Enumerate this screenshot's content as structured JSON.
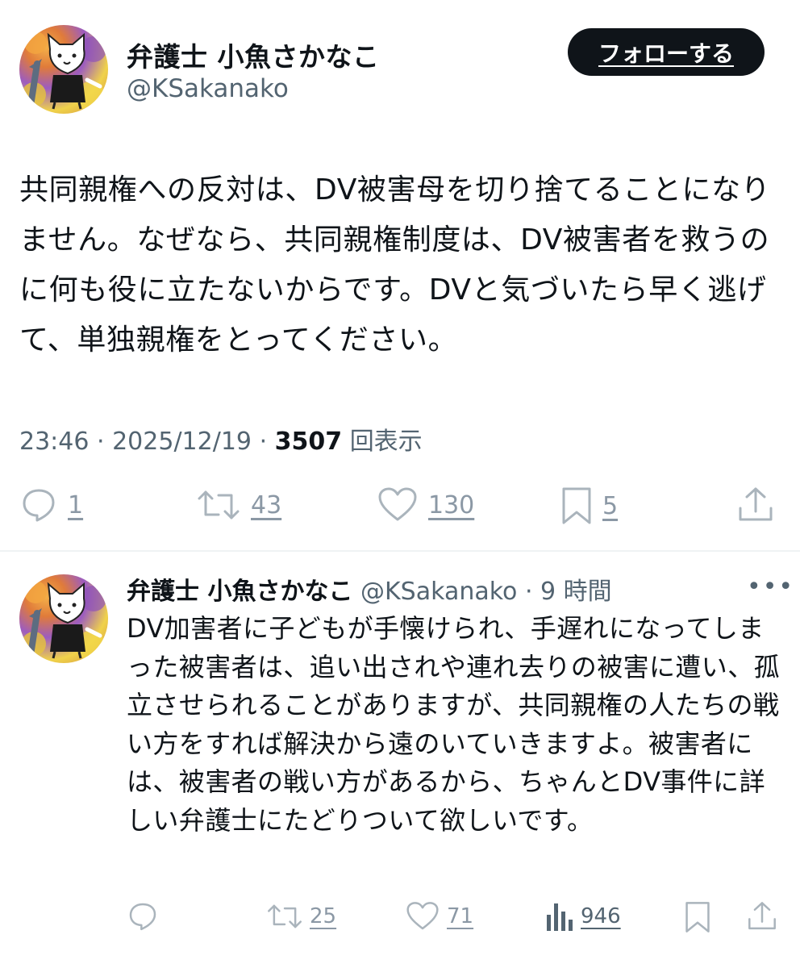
{
  "tweet": {
    "author": {
      "display_name": "弁護士 小魚さかなこ",
      "handle": "@KSakanako",
      "avatar_icon": "cat-holding-fish-avatar"
    },
    "follow_label": "フォローする",
    "text": "共同親権への反対は、DV被害母を切り捨てることになりません。なぜなら、共同親権制度は、DV被害者を救うのに何も役に立たないからです。DVと気づいたら早く逃げて、単独親権をとってください。",
    "time": "23:46",
    "date": "2025/12/19",
    "views_count": "3507",
    "views_label": "回表示",
    "stats": {
      "replies": "1",
      "retweets": "43",
      "likes": "130",
      "bookmarks": "5"
    }
  },
  "reply": {
    "author": {
      "display_name": "弁護士 小魚さかなこ",
      "handle": "@KSakanako",
      "avatar_icon": "cat-holding-fish-avatar"
    },
    "separator": "·",
    "time_ago": "9 時間",
    "more_label": "•••",
    "text": "DV加害者に子どもが手懐けられ、手遅れになってしまった被害者は、追い出されや連れ去りの被害に遭い、孤立させられることがありますが、共同親権の人たちの戦い方をすれば解決から遠のいていきますよ。被害者には、被害者の戦い方があるから、ちゃんとDV事件に詳しい弁護士にたどりついて欲しいです。",
    "stats": {
      "retweets": "25",
      "likes": "71",
      "views": "946"
    }
  },
  "colors": {
    "text": "#0f1419",
    "secondary": "#536471",
    "icon": "#aab4bc",
    "follow_bg": "#0f1419",
    "divider": "#eff3f4"
  },
  "icons": [
    "reply-icon",
    "retweet-icon",
    "like-icon",
    "bookmark-icon",
    "share-icon",
    "views-icon",
    "more-icon"
  ]
}
